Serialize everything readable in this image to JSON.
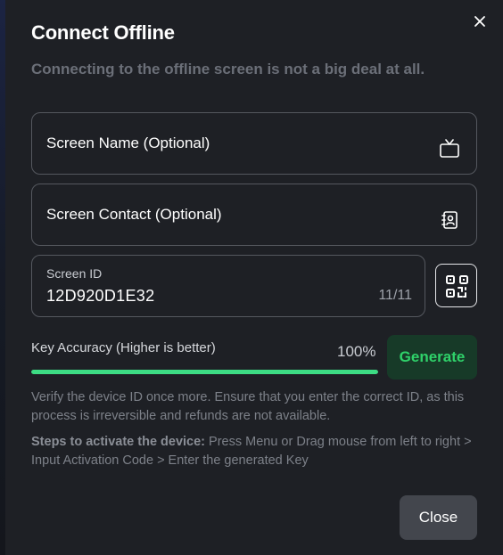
{
  "dialog": {
    "title": "Connect Offline",
    "subtitle": "Connecting to the offline screen is not a big deal at all.",
    "close_icon": "close-icon"
  },
  "fields": {
    "screen_name": {
      "label": "Screen Name (Optional)",
      "icon": "tv-icon"
    },
    "screen_contact": {
      "label": "Screen Contact (Optional)",
      "icon": "contact-book-icon"
    },
    "screen_id": {
      "label": "Screen ID",
      "value": "12D920D1E32",
      "counter": "11/11"
    }
  },
  "qr_button": {
    "icon": "qr-code-icon"
  },
  "accuracy": {
    "label": "Key Accuracy (Higher is better)",
    "value_text": "100%",
    "value": 1.0,
    "fill_color": "#3ddc84"
  },
  "generate_button": {
    "label": "Generate",
    "color": "#2fd26a"
  },
  "notice": "Verify the device ID once more. Ensure that you enter the correct ID, as this process is irreversible and refunds are not available.",
  "steps": {
    "heading": "Steps to activate the device:",
    "text": " Press Menu or Drag mouse from left to right > Input Activation Code > Enter the generated Key"
  },
  "close_button": {
    "label": "Close"
  }
}
